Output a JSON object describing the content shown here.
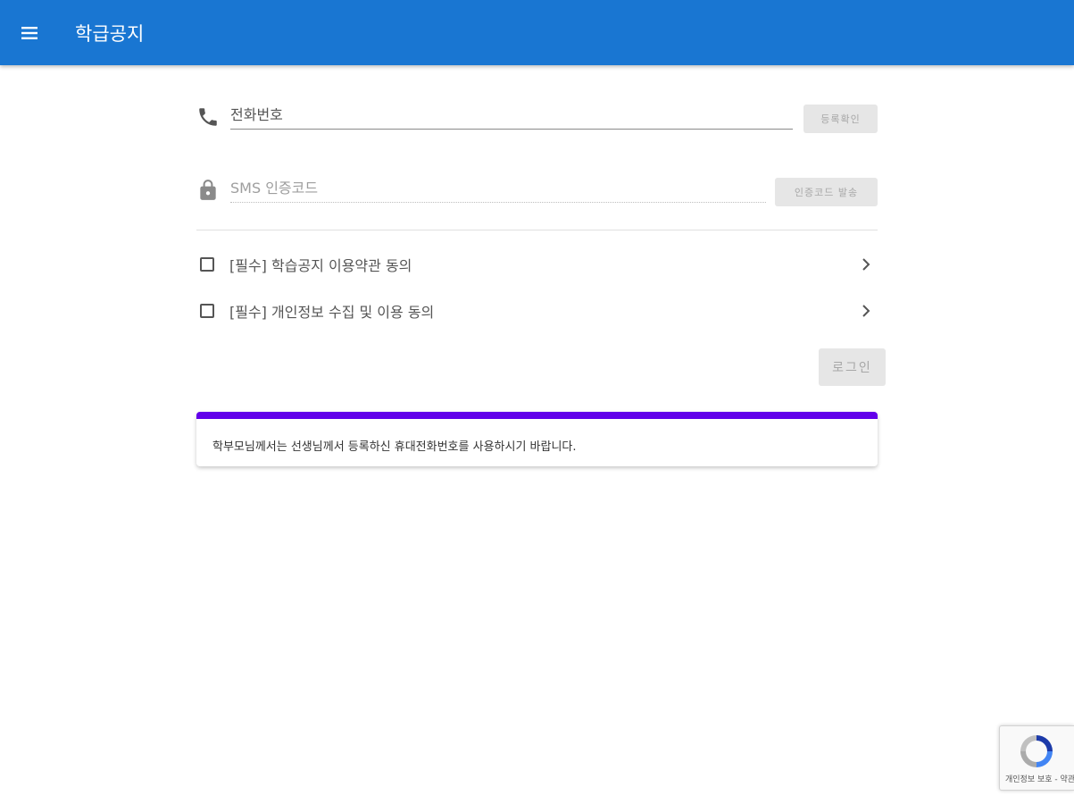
{
  "app_bar": {
    "title": "학급공지",
    "menu_icon": "menu-icon",
    "color": "#1976d2"
  },
  "login_form": {
    "phone": {
      "icon": "phone-icon",
      "placeholder": "전화번호",
      "value": "",
      "button_label": "등록확인"
    },
    "sms": {
      "icon": "lock-icon",
      "placeholder": "SMS 인증코드",
      "value": "",
      "button_label": "인증코드 발송"
    },
    "agreements": [
      {
        "label": "[필수] 학습공지 이용약관 동의",
        "checked": false,
        "icon": "chevron-right-icon"
      },
      {
        "label": "[필수] 개인정보 수집 및 이용 동의",
        "checked": false,
        "icon": "chevron-right-icon"
      }
    ],
    "login_label": "로그인"
  },
  "notice": {
    "text": "학부모님께서는 선생님께서 등록하신 휴대전화번호를 사용하시기 바랍니다.",
    "accent_color": "#6200ea"
  },
  "recaptcha": {
    "label": "개인정보 보호 - 약관",
    "icon": "recaptcha-icon"
  }
}
